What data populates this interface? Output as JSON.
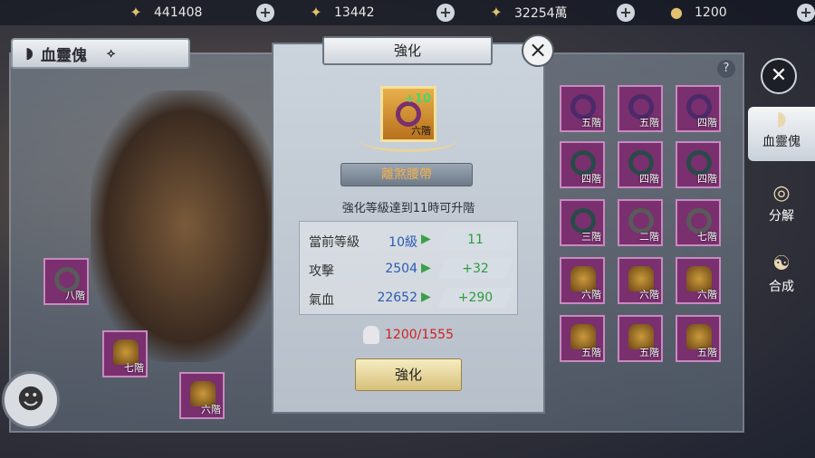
{
  "topbar": {
    "resources": [
      {
        "icon": "gold-ingot-icon",
        "value": "441408"
      },
      {
        "icon": "gold-coins-icon",
        "value": "13442"
      },
      {
        "icon": "silver-icon",
        "value": "32254萬"
      },
      {
        "icon": "pouch-icon",
        "value": "1200"
      }
    ]
  },
  "panel": {
    "title": "血靈傀"
  },
  "side_tabs": [
    {
      "label": "血靈傀",
      "icon": "blood-puppet-icon"
    },
    {
      "label": "分解",
      "icon": "decompose-icon"
    },
    {
      "label": "合成",
      "icon": "synthesize-icon"
    }
  ],
  "equipped": [
    {
      "lv": "八階"
    },
    {
      "lv": "七階"
    },
    {
      "lv": "六階"
    }
  ],
  "inventory": [
    {
      "lv": "五階"
    },
    {
      "lv": "五階"
    },
    {
      "lv": "四階"
    },
    {
      "lv": "四階"
    },
    {
      "lv": "四階"
    },
    {
      "lv": "四階"
    },
    {
      "lv": "三階"
    },
    {
      "lv": "二階"
    },
    {
      "lv": "七階"
    },
    {
      "lv": "六階"
    },
    {
      "lv": "六階"
    },
    {
      "lv": "六階"
    },
    {
      "lv": "五階"
    },
    {
      "lv": "五階"
    },
    {
      "lv": "五階"
    }
  ],
  "modal": {
    "title": "強化",
    "item": {
      "plus": "+10",
      "lv": "六階",
      "name": "離煞腰帶"
    },
    "hint": "強化等級達到11時可升階",
    "stats": [
      {
        "label": "當前等級",
        "current": "10級",
        "next": "11"
      },
      {
        "label": "攻擊",
        "current": "2504",
        "next": "+32"
      },
      {
        "label": "氣血",
        "current": "22652",
        "next": "+290"
      }
    ],
    "cost": "1200/1555",
    "button": "強化"
  }
}
